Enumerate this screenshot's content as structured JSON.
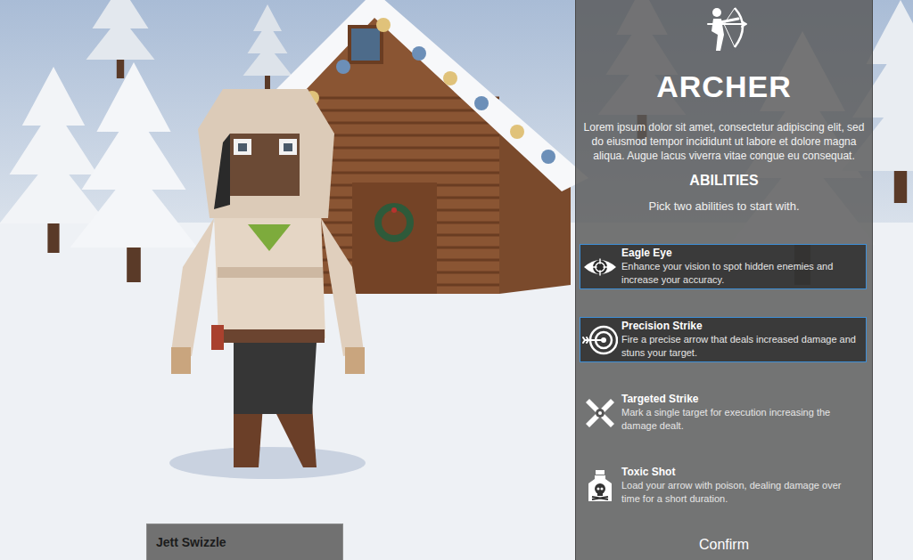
{
  "character": {
    "name": "Jett Swizzle"
  },
  "class": {
    "title": "ARCHER",
    "description": "Lorem ipsum dolor sit amet, consectetur adipiscing elit, sed do eiusmod tempor incididunt ut labore et dolore magna aliqua. Augue lacus viverra vitae congue eu consequat."
  },
  "abilities_section": {
    "title": "ABILITIES",
    "instructions": "Pick two abilities to start with."
  },
  "abilities": [
    {
      "name": "Eagle Eye",
      "description": "Enhance your vision to spot hidden enemies and increase your accuracy.",
      "selected": true
    },
    {
      "name": "Precision Strike",
      "description": "Fire a precise arrow that deals increased damage and stuns your target.",
      "selected": true
    },
    {
      "name": "Targeted Strike",
      "description": "Mark a single target for execution increasing the damage dealt.",
      "selected": false
    },
    {
      "name": "Toxic Shot",
      "description": "Load your arrow with poison, dealing damage over time for a short duration.",
      "selected": false
    }
  ],
  "buttons": [
    "Confirm"
  ]
}
